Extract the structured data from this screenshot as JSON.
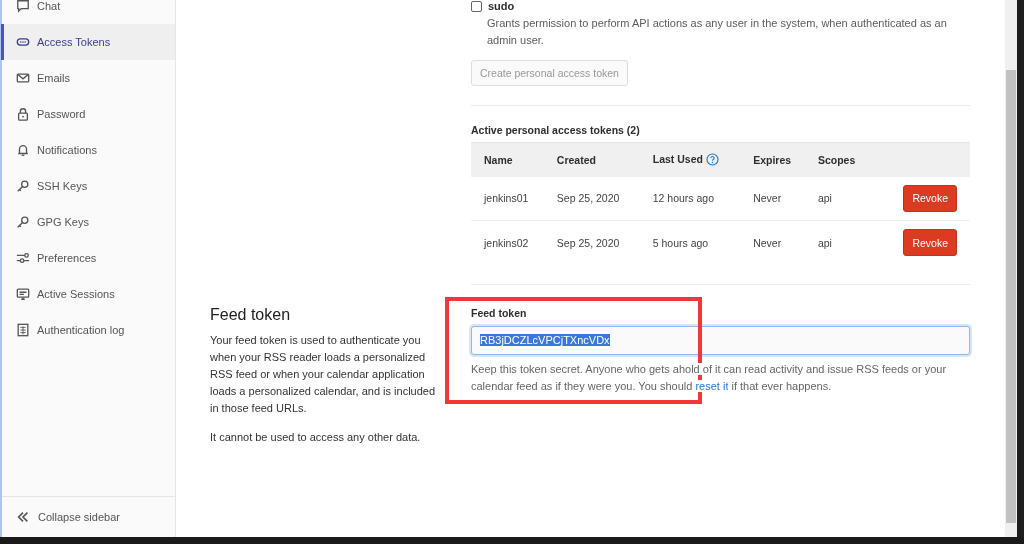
{
  "sidebar": {
    "items": [
      {
        "label": "Chat",
        "selected": false
      },
      {
        "label": "Access Tokens",
        "selected": true
      },
      {
        "label": "Emails",
        "selected": false
      },
      {
        "label": "Password",
        "selected": false
      },
      {
        "label": "Notifications",
        "selected": false
      },
      {
        "label": "SSH Keys",
        "selected": false
      },
      {
        "label": "GPG Keys",
        "selected": false
      },
      {
        "label": "Preferences",
        "selected": false
      },
      {
        "label": "Active Sessions",
        "selected": false
      },
      {
        "label": "Authentication log",
        "selected": false
      }
    ],
    "collapse": "Collapse sidebar"
  },
  "scopes": [
    {
      "name": "sudo",
      "checked": false,
      "description": "Grants permission to perform API actions as any user in the system, when authenticated as an admin user."
    }
  ],
  "create_button": {
    "label": "Create personal access token",
    "disabled": true
  },
  "active_tokens": {
    "title": "Active personal access tokens (2)",
    "columns": [
      "Name",
      "Created",
      "Last Used",
      "Expires",
      "Scopes"
    ],
    "rows": [
      {
        "name": "jenkins01",
        "created": "Sep 25, 2020",
        "last_used": "12 hours ago",
        "expires": "Never",
        "scopes": "api",
        "action": "Revoke"
      },
      {
        "name": "jenkins02",
        "created": "Sep 25, 2020",
        "last_used": "5 hours ago",
        "expires": "Never",
        "scopes": "api",
        "action": "Revoke"
      }
    ]
  },
  "feed_token": {
    "heading": "Feed token",
    "description": [
      "Your feed token is used to authenticate you when your RSS reader loads a personalized RSS feed or when your calendar application loads a personalized calendar, and is included in those feed URLs.",
      "It cannot be used to access any other data."
    ],
    "field_label": "Feed token",
    "value": "RB3jDCZLcVPCjTXncVDx",
    "text_selected": true,
    "help_before": "Keep this token secret. Anyone who gets ahold of it can read activity and issue RSS feeds or your calendar feed as if they were you. You should",
    "help_link": "reset it",
    "help_after": "if that ever happens."
  }
}
